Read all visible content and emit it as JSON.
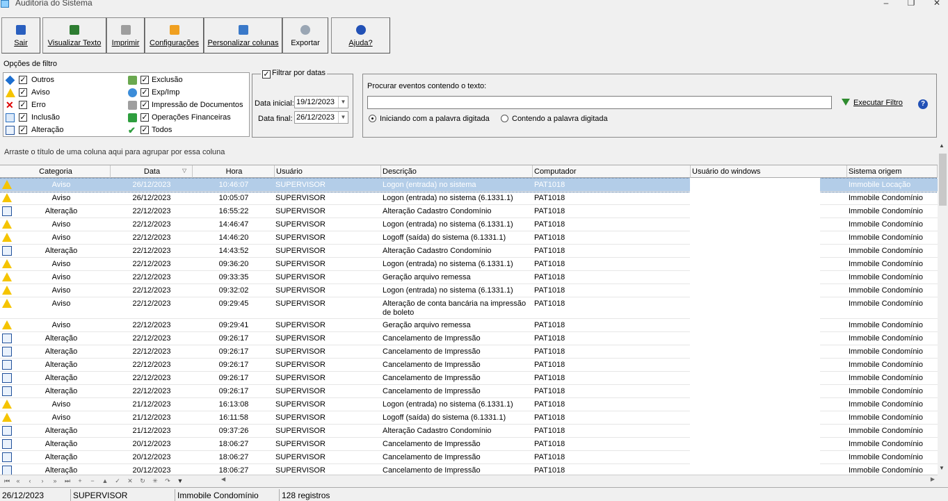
{
  "window": {
    "title": "Auditoria do Sistema",
    "min": "–",
    "restore": "❐",
    "close": "✕"
  },
  "toolbar": {
    "sair": "Sair",
    "visualizar": "Visualizar Texto",
    "imprimir": "Imprimir",
    "configuracoes": "Configurações",
    "personalizar": "Personalizar colunas",
    "exportar": "Exportar",
    "ajuda": "Ajuda?"
  },
  "filters": {
    "title": "Opções de filtro",
    "col1": [
      "Outros",
      "Aviso",
      "Erro",
      "Inclusão",
      "Alteração"
    ],
    "col2": [
      "Exclusão",
      "Exp/Imp",
      "Impressão de Documentos",
      "Operações Financeiras",
      "Todos"
    ]
  },
  "date_filter": {
    "legend": "Filtrar por datas",
    "start_label": "Data inicial:",
    "start_value": "19/12/2023",
    "end_label": "Data final:",
    "end_value": "26/12/2023"
  },
  "search": {
    "label": "Procurar eventos contendo o texto:",
    "value": "",
    "radio_starts": "Iniciando com a palavra digitada",
    "radio_contains": "Contendo a palavra digitada",
    "execute": "Executar Filtro"
  },
  "grid": {
    "group_hint": "Arraste o título de uma coluna aqui para agrupar por essa coluna",
    "columns": [
      "Categoria",
      "Data",
      "Hora",
      "Usuário",
      "Descrição",
      "Computador",
      "Usuário do windows",
      "Sistema origem"
    ],
    "rows": [
      {
        "cat": "Aviso",
        "date": "26/12/2023",
        "time": "10:46:07",
        "user": "SUPERVISOR",
        "desc": "Logon (entrada) no sistema",
        "pc": "PAT1018",
        "sys": "Immobile Locação",
        "selected": true
      },
      {
        "cat": "Aviso",
        "date": "26/12/2023",
        "time": "10:05:07",
        "user": "SUPERVISOR",
        "desc": "Logon (entrada) no sistema (6.1331.1)",
        "pc": "PAT1018",
        "sys": "Immobile Condomínio"
      },
      {
        "cat": "Alteração",
        "date": "22/12/2023",
        "time": "16:55:22",
        "user": "SUPERVISOR",
        "desc": "Alteração Cadastro Condomínio",
        "pc": "PAT1018",
        "sys": "Immobile Condomínio"
      },
      {
        "cat": "Aviso",
        "date": "22/12/2023",
        "time": "14:46:47",
        "user": "SUPERVISOR",
        "desc": "Logon (entrada) no sistema (6.1331.1)",
        "pc": "PAT1018",
        "sys": "Immobile Condomínio"
      },
      {
        "cat": "Aviso",
        "date": "22/12/2023",
        "time": "14:46:20",
        "user": "SUPERVISOR",
        "desc": "Logoff (saída) do sistema (6.1331.1)",
        "pc": "PAT1018",
        "sys": "Immobile Condomínio"
      },
      {
        "cat": "Alteração",
        "date": "22/12/2023",
        "time": "14:43:52",
        "user": "SUPERVISOR",
        "desc": "Alteração Cadastro Condomínio",
        "pc": "PAT1018",
        "sys": "Immobile Condomínio"
      },
      {
        "cat": "Aviso",
        "date": "22/12/2023",
        "time": "09:36:20",
        "user": "SUPERVISOR",
        "desc": "Logon (entrada) no sistema (6.1331.1)",
        "pc": "PAT1018",
        "sys": "Immobile Condomínio"
      },
      {
        "cat": "Aviso",
        "date": "22/12/2023",
        "time": "09:33:35",
        "user": "SUPERVISOR",
        "desc": "Geração arquivo remessa",
        "pc": "PAT1018",
        "sys": "Immobile Condomínio"
      },
      {
        "cat": "Aviso",
        "date": "22/12/2023",
        "time": "09:32:02",
        "user": "SUPERVISOR",
        "desc": "Logon (entrada) no sistema (6.1331.1)",
        "pc": "PAT1018",
        "sys": "Immobile Condomínio"
      },
      {
        "cat": "Aviso",
        "date": "22/12/2023",
        "time": "09:29:45",
        "user": "SUPERVISOR",
        "desc": "Alteração de conta bancária na impressão de boleto",
        "pc": "PAT1018",
        "sys": "Immobile Condomínio",
        "tall": true
      },
      {
        "cat": "Aviso",
        "date": "22/12/2023",
        "time": "09:29:41",
        "user": "SUPERVISOR",
        "desc": "Geração arquivo remessa",
        "pc": "PAT1018",
        "sys": "Immobile Condomínio"
      },
      {
        "cat": "Alteração",
        "date": "22/12/2023",
        "time": "09:26:17",
        "user": "SUPERVISOR",
        "desc": "Cancelamento de Impressão",
        "pc": "PAT1018",
        "sys": "Immobile Condomínio"
      },
      {
        "cat": "Alteração",
        "date": "22/12/2023",
        "time": "09:26:17",
        "user": "SUPERVISOR",
        "desc": "Cancelamento de Impressão",
        "pc": "PAT1018",
        "sys": "Immobile Condomínio"
      },
      {
        "cat": "Alteração",
        "date": "22/12/2023",
        "time": "09:26:17",
        "user": "SUPERVISOR",
        "desc": "Cancelamento de Impressão",
        "pc": "PAT1018",
        "sys": "Immobile Condomínio"
      },
      {
        "cat": "Alteração",
        "date": "22/12/2023",
        "time": "09:26:17",
        "user": "SUPERVISOR",
        "desc": "Cancelamento de Impressão",
        "pc": "PAT1018",
        "sys": "Immobile Condomínio"
      },
      {
        "cat": "Alteração",
        "date": "22/12/2023",
        "time": "09:26:17",
        "user": "SUPERVISOR",
        "desc": "Cancelamento de Impressão",
        "pc": "PAT1018",
        "sys": "Immobile Condomínio"
      },
      {
        "cat": "Aviso",
        "date": "21/12/2023",
        "time": "16:13:08",
        "user": "SUPERVISOR",
        "desc": "Logon (entrada) no sistema (6.1331.1)",
        "pc": "PAT1018",
        "sys": "Immobile Condomínio"
      },
      {
        "cat": "Aviso",
        "date": "21/12/2023",
        "time": "16:11:58",
        "user": "SUPERVISOR",
        "desc": "Logoff (saída) do sistema (6.1331.1)",
        "pc": "PAT1018",
        "sys": "Immobile Condomínio"
      },
      {
        "cat": "Alteração",
        "date": "21/12/2023",
        "time": "09:37:26",
        "user": "SUPERVISOR",
        "desc": "Alteração Cadastro Condomínio",
        "pc": "PAT1018",
        "sys": "Immobile Condomínio"
      },
      {
        "cat": "Alteração",
        "date": "20/12/2023",
        "time": "18:06:27",
        "user": "SUPERVISOR",
        "desc": "Cancelamento de Impressão",
        "pc": "PAT1018",
        "sys": "Immobile Condomínio"
      },
      {
        "cat": "Alteração",
        "date": "20/12/2023",
        "time": "18:06:27",
        "user": "SUPERVISOR",
        "desc": "Cancelamento de Impressão",
        "pc": "PAT1018",
        "sys": "Immobile Condomínio"
      },
      {
        "cat": "Alteração",
        "date": "20/12/2023",
        "time": "18:06:27",
        "user": "SUPERVISOR",
        "desc": "Cancelamento de Impressão",
        "pc": "PAT1018",
        "sys": "Immobile Condomínio"
      }
    ]
  },
  "status": {
    "date": "26/12/2023",
    "user": "SUPERVISOR",
    "system": "Immobile Condomínio",
    "count": "128 registros"
  }
}
